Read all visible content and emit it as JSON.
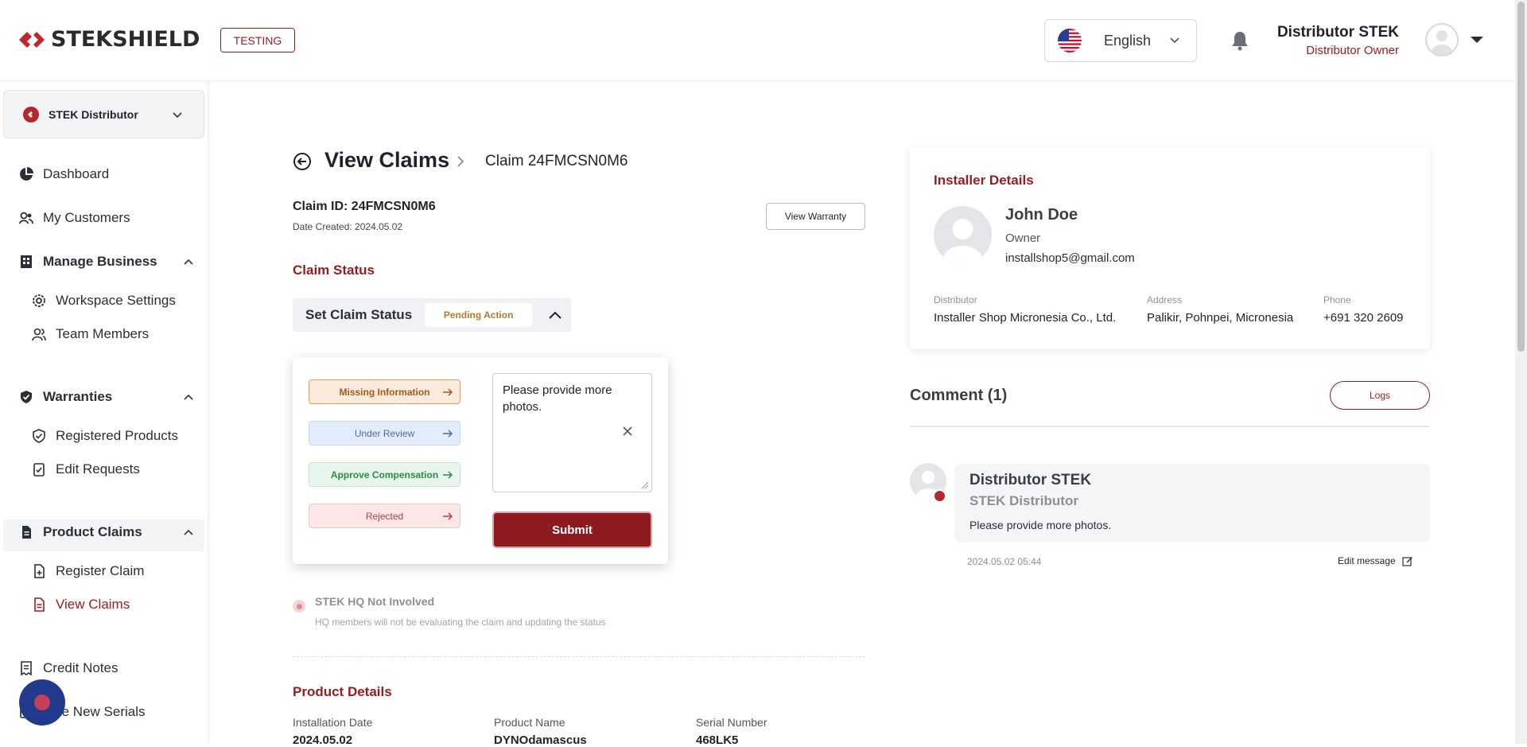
{
  "header": {
    "logo_text": "STEKSHIELD",
    "env_badge": "TESTING",
    "language": "English",
    "user_name": "Distributor STEK",
    "user_role": "Distributor Owner"
  },
  "sidebar": {
    "org_name": "STEK Distributor",
    "items": {
      "dashboard": "Dashboard",
      "my_customers": "My Customers",
      "manage_business": "Manage Business",
      "workspace_settings": "Workspace Settings",
      "team_members": "Team Members",
      "warranties": "Warranties",
      "registered_products": "Registered Products",
      "edit_requests": "Edit Requests",
      "product_claims": "Product Claims",
      "register_claim": "Register Claim",
      "view_claims": "View Claims",
      "credit_notes": "Credit Notes",
      "create_new_serials": "eate New Serials"
    }
  },
  "main": {
    "title": "View Claims",
    "breadcrumb": "Claim 24FMCSN0M6",
    "claim_id": "Claim ID: 24FMCSN0M6",
    "date_created": "Date Created: 2024.05.02",
    "view_warranty_label": "View Warranty",
    "claim_status_title": "Claim Status",
    "set_status_label": "Set Claim Status",
    "current_status": "Pending Action",
    "status_options": {
      "missing": "Missing Information",
      "review": "Under Review",
      "approve": "Approve Compensation",
      "rejected": "Rejected"
    },
    "comment_value": "Please provide more photos.",
    "submit_label": "Submit",
    "hq_title": "STEK HQ Not Involved",
    "hq_desc": "HQ members will not be evaluating the claim and updating the status",
    "product_details_title": "Product Details",
    "product_details": {
      "installation_date_label": "Installation Date",
      "installation_date": "2024.05.02",
      "product_name_label": "Product Name",
      "product_name": "DYNOdamascus",
      "serial_number_label": "Serial Number",
      "serial_number": "468LK5"
    }
  },
  "installer": {
    "title": "Installer Details",
    "name": "John Doe",
    "role": "Owner",
    "email": "installshop5@gmail.com",
    "distributor_label": "Distributor",
    "distributor": "Installer Shop Micronesia Co., Ltd.",
    "address_label": "Address",
    "address": "Palikir, Pohnpei, Micronesia",
    "phone_label": "Phone",
    "phone": "+691 320 2609"
  },
  "comments": {
    "title": "Comment (1)",
    "logs_label": "Logs",
    "author": "Distributor STEK",
    "author_org": "STEK Distributor",
    "text": "Please provide more photos.",
    "timestamp": "2024.05.02 05:44",
    "edit_label": "Edit message"
  },
  "colors": {
    "brand": "#9a1b1f",
    "submit": "#8d1a1e",
    "pending": "#b7792b"
  }
}
